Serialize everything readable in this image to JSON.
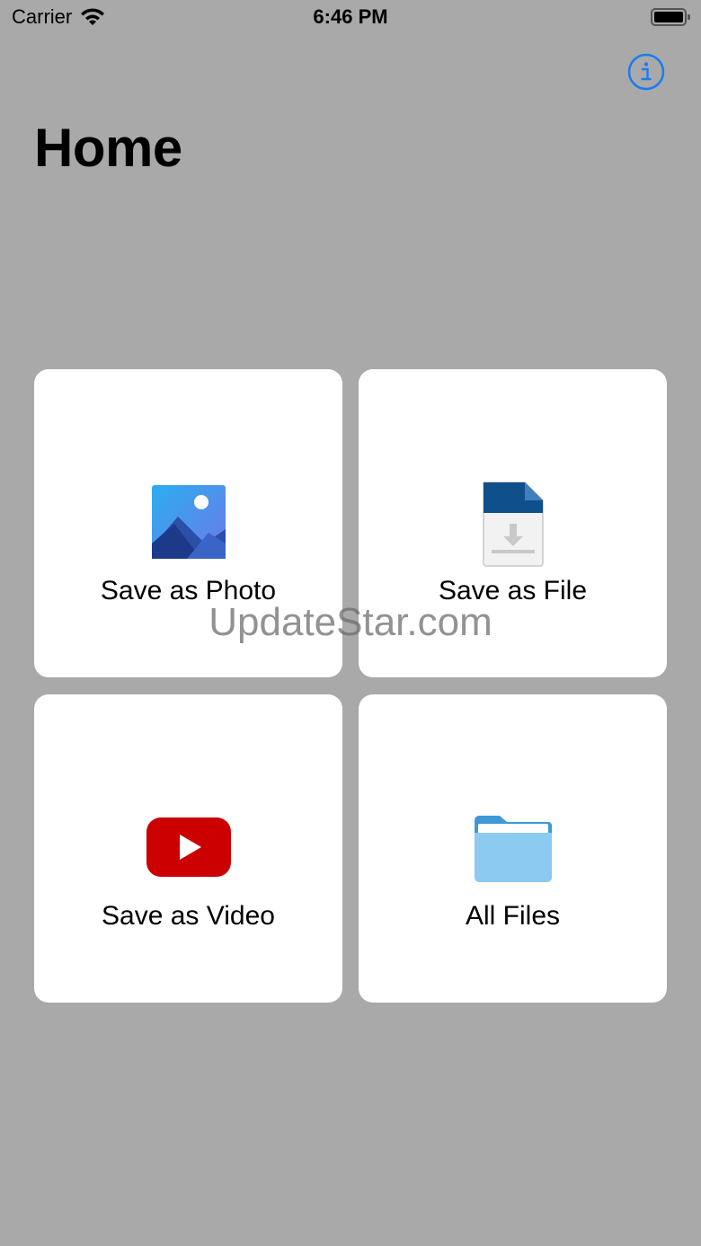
{
  "status_bar": {
    "carrier": "Carrier",
    "time": "6:46 PM"
  },
  "nav": {
    "title": "Home",
    "info_icon": "info-circle-icon"
  },
  "tiles": [
    {
      "label": "Save as Photo",
      "icon": "photo-icon"
    },
    {
      "label": "Save as File",
      "icon": "file-download-icon"
    },
    {
      "label": "Save as Video",
      "icon": "youtube-play-icon"
    },
    {
      "label": "All Files",
      "icon": "folder-icon"
    }
  ],
  "watermark": "UpdateStar.com",
  "colors": {
    "background": "#a9a9a9",
    "tile": "#ffffff",
    "accent": "#1a7cf0",
    "video_red": "#cc0000",
    "folder_blue": "#8ccaf2"
  }
}
